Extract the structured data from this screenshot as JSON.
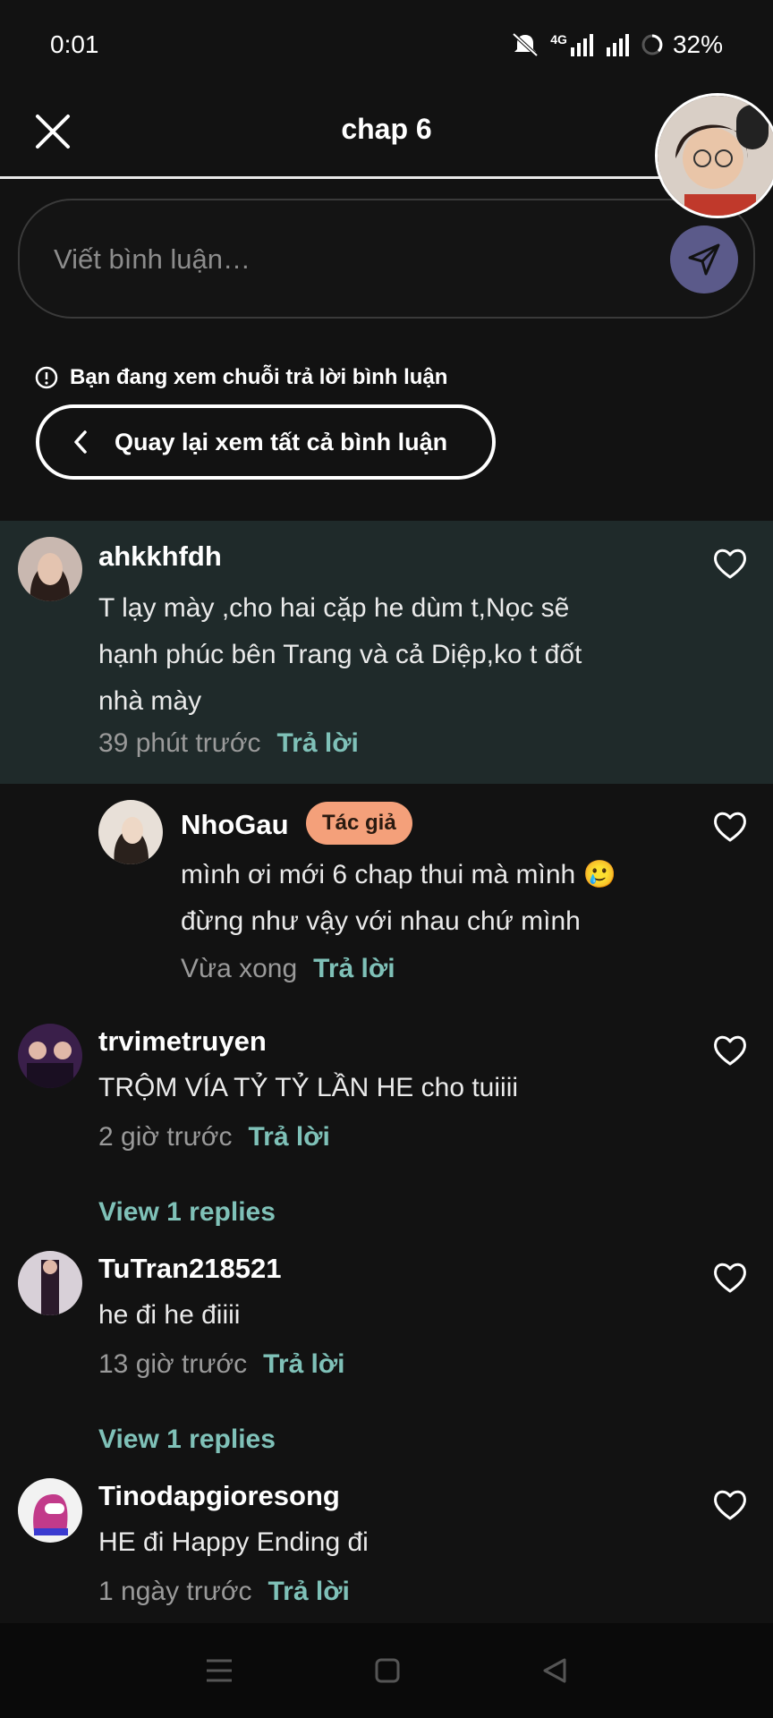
{
  "status_bar": {
    "time": "0:01",
    "network": "4G",
    "battery": "32%"
  },
  "header": {
    "title": "chap 6"
  },
  "composer": {
    "placeholder": "Viết bình luận…"
  },
  "thread": {
    "notice": "Bạn đang xem chuỗi trả lời bình luận",
    "back_label": "Quay lại xem tất cả bình luận"
  },
  "reply_label": "Trả lời",
  "comments": [
    {
      "username": "ahkkhfdh",
      "lines": [
        "T lạy mày ,cho hai cặp he dùm t,Nọc sẽ",
        "hạnh phúc bên Trang và cả Diệp,ko t đốt",
        "nhà mày"
      ],
      "time": "39 phút trước"
    },
    {
      "username": "NhoGau",
      "badge": "Tác giả",
      "lines": [
        "mình ơi  mới 6 chap thui mà mình 🥲",
        "đừng như vậy với nhau chứ mình"
      ],
      "time": "Vừa xong"
    },
    {
      "username": "trvimetruyen",
      "lines": [
        "TRỘM VÍA TỶ TỶ LẦN HE cho tuiiii"
      ],
      "time": "2 giờ trước",
      "view_replies": "View 1 replies"
    },
    {
      "username": "TuTran218521",
      "lines": [
        "he đi he điiii"
      ],
      "time": "13 giờ trước",
      "view_replies": "View 1 replies"
    },
    {
      "username": "Tinodapgioresong",
      "lines": [
        "HE đi Happy Ending đi"
      ],
      "time": "1 ngày trước"
    }
  ],
  "colors": {
    "accent": "#7fc1b8",
    "badge": "#f4a07a",
    "send": "#5b5a8a",
    "highlight": "#1f2a2a"
  }
}
